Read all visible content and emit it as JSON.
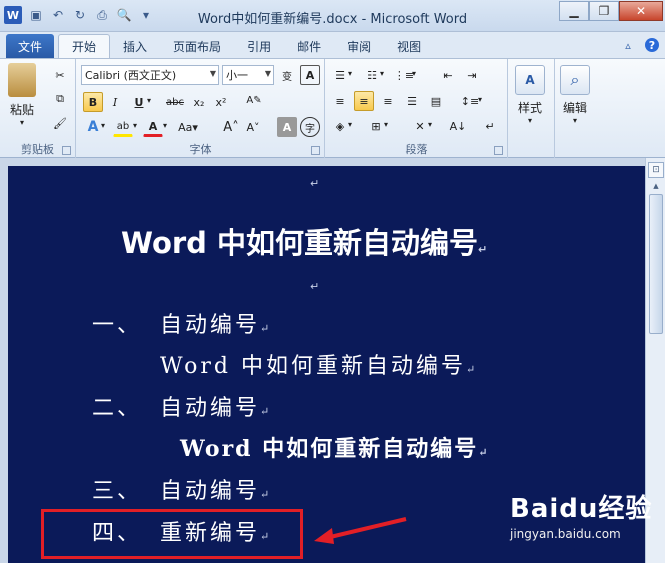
{
  "window": {
    "title": "Word中如何重新编号.docx - Microsoft Word",
    "app_icon": "W"
  },
  "tabs": [
    "文件",
    "开始",
    "插入",
    "页面布局",
    "引用",
    "邮件",
    "审阅",
    "视图"
  ],
  "ribbon": {
    "clipboard": {
      "label": "剪贴板",
      "paste": "粘贴"
    },
    "font": {
      "label": "字体",
      "font_name": "Calibri (西文正文)",
      "font_size": "小一",
      "wen": "wen"
    },
    "paragraph": {
      "label": "段落"
    },
    "styles": {
      "label": "样式"
    },
    "editing": {
      "label": "编辑"
    }
  },
  "document": {
    "title": "Word 中如何重新自动编号",
    "items": [
      {
        "num": "一、",
        "text": "自动编号"
      },
      {
        "sub": "Word 中如何重新自动编号"
      },
      {
        "num": "二、",
        "text": "自动编号"
      },
      {
        "sub_bold": "Word 中如何重新自动编号"
      },
      {
        "num": "三、",
        "text": "自动编号"
      },
      {
        "num": "四、",
        "text": "重新编号"
      }
    ],
    "para_mark": "↵"
  },
  "watermark": {
    "brand": "Baidu经验",
    "url": "jingyan.baidu.com"
  },
  "colors": {
    "page": "#0b1a59",
    "highlight": "#e21f26",
    "file_tab": "#2a5aa6"
  }
}
